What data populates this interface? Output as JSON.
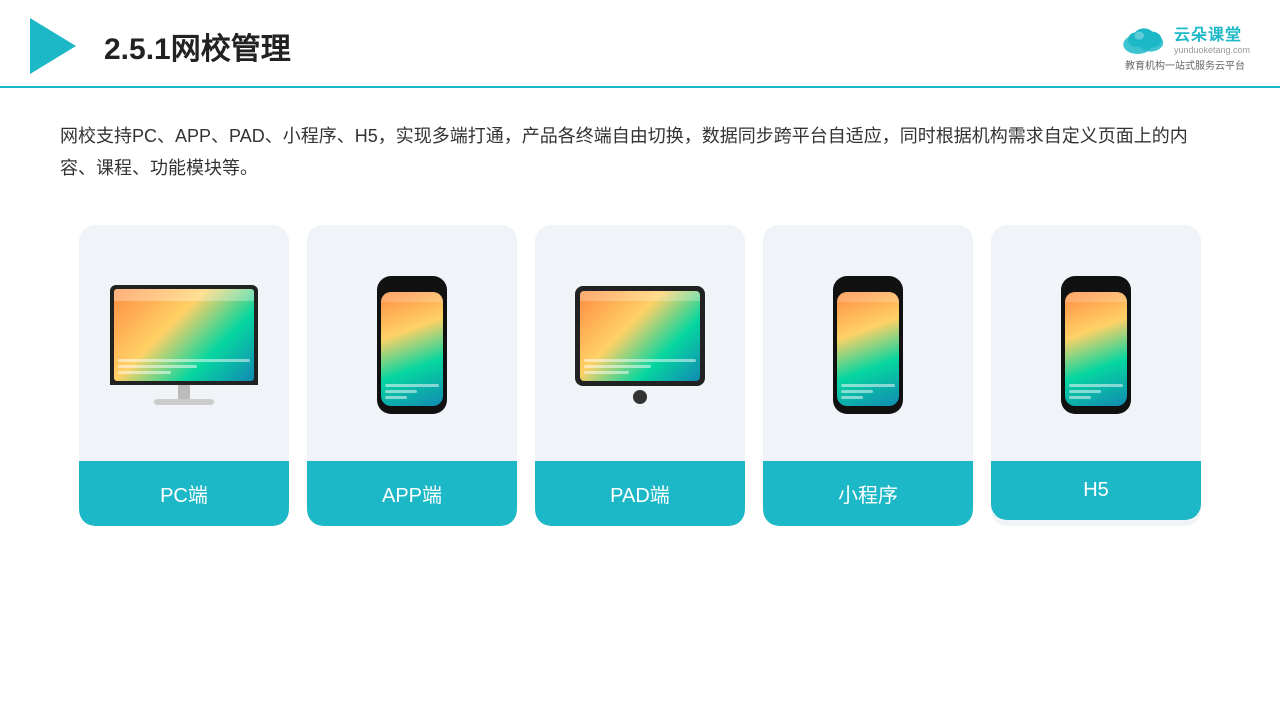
{
  "header": {
    "title": "2.5.1网校管理",
    "brand_name": "云朵课堂",
    "brand_url": "yunduoketang.com",
    "brand_tagline": "教育机构一站\n式服务云平台"
  },
  "description": {
    "text": "网校支持PC、APP、PAD、小程序、H5，实现多端打通，产品各终端自由切换，数据同步跨平台自适应，同时根据机构需求自定义页面上的内容、课程、功能模块等。"
  },
  "cards": [
    {
      "id": "pc",
      "label": "PC端"
    },
    {
      "id": "app",
      "label": "APP端"
    },
    {
      "id": "pad",
      "label": "PAD端"
    },
    {
      "id": "mini",
      "label": "小程序"
    },
    {
      "id": "h5",
      "label": "H5"
    }
  ]
}
